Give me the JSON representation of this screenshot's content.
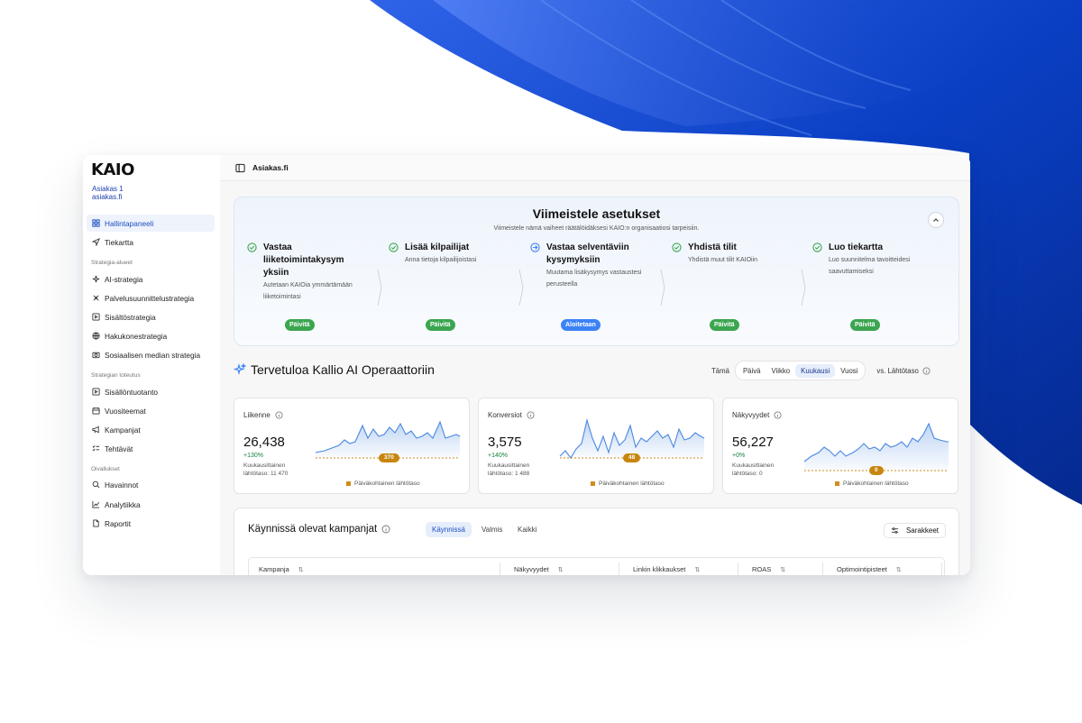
{
  "sidebar": {
    "logo": "KAIO",
    "account_name": "Asiakas 1",
    "account_domain": "asiakas.fi",
    "items": [
      {
        "label": "Hallintapaneeli",
        "icon": "grid-icon",
        "active": true
      },
      {
        "label": "Tiekartta",
        "icon": "navigation-icon"
      }
    ],
    "section1": "Strategia-alueet",
    "strategy_items": [
      {
        "label": "AI-strategia",
        "icon": "sparkles-icon"
      },
      {
        "label": "Palvelusuunnittelustrategia",
        "icon": "compass-icon"
      },
      {
        "label": "Sisältöstrategia",
        "icon": "play-square-icon"
      },
      {
        "label": "Hakukonestrategia",
        "icon": "globe-icon"
      },
      {
        "label": "Sosiaalisen median strategia",
        "icon": "camera-icon"
      }
    ],
    "section2": "Strategian toteutus",
    "execution_items": [
      {
        "label": "Sisällöntuotanto",
        "icon": "play-square-icon"
      },
      {
        "label": "Vuositeemat",
        "icon": "calendar-icon"
      },
      {
        "label": "Kampanjat",
        "icon": "megaphone-icon"
      },
      {
        "label": "Tehtävät",
        "icon": "list-check-icon"
      }
    ],
    "section3": "Oivallukset",
    "insight_items": [
      {
        "label": "Havainnot",
        "icon": "search-icon"
      },
      {
        "label": "Analytiikka",
        "icon": "chart-line-icon"
      },
      {
        "label": "Raportit",
        "icon": "file-icon"
      }
    ]
  },
  "topbar": {
    "title": "Asiakas.fi",
    "icon": "sidebar-toggle-icon"
  },
  "setup": {
    "title": "Viimeistele asetukset",
    "subtitle": "Viimeistele nämä vaiheet räätälöidäksesi KAIO:n organisaatiosi tarpeisiin.",
    "steps": [
      {
        "title": "Vastaa liiketoimintakysym yksiin",
        "desc": "Autetaan KAIOia ymmärtämään liiketoimintasi",
        "button": "Päivitä",
        "status": "done"
      },
      {
        "title": "Lisää kilpailijat",
        "desc": "Anna tietoja kilpailijoistasi",
        "button": "Päivitä",
        "status": "done"
      },
      {
        "title": "Vastaa selventäviin kysymyksiin",
        "desc": "Muutama lisäkysymys vastaustesi perusteella",
        "button": "Aloitetaan",
        "status": "current"
      },
      {
        "title": "Yhdistä tilit",
        "desc": "Yhdistä muut tilit KAIOiin",
        "button": "Päivitä",
        "status": "done"
      },
      {
        "title": "Luo tiekartta",
        "desc": "Luo suunnitelma tavoitteidesi saavuttamiseksi",
        "button": "Päivitä",
        "status": "done"
      }
    ]
  },
  "welcome": {
    "title": "Tervetuloa Kallio AI Operaattoriin"
  },
  "period": {
    "label": "Tämä",
    "options": [
      "Päivä",
      "Viikko",
      "Kuukausi",
      "Vuosi"
    ],
    "selected": "Kuukausi",
    "compare": "vs. Lähtötaso"
  },
  "kpis": [
    {
      "name": "Liikenne",
      "value": "26,438",
      "change": "+130%",
      "baseline_label": "Kuukausittainen lähtötaso: 11 470",
      "baseline_badge": "370",
      "legend": "Päiväkohtainen lähtötaso"
    },
    {
      "name": "Konversiot",
      "value": "3,575",
      "change": "+140%",
      "baseline_label": "Kuukausittainen lähtötaso: 1 488",
      "baseline_badge": "48",
      "legend": "Päiväkohtainen lähtötaso"
    },
    {
      "name": "Näkyvyydet",
      "value": "56,227",
      "change": "+0%",
      "baseline_label": "Kuukausittainen lähtötaso: 0",
      "baseline_badge": "0",
      "legend": "Päiväkohtainen lähtötaso"
    }
  ],
  "campaigns": {
    "title": "Käynnissä olevat kampanjat",
    "tabs": [
      "Käynnissä",
      "Valmis",
      "Kaikki"
    ],
    "active_tab": "Käynnissä",
    "columns_button": "Sarakkeet",
    "columns": [
      "Kampanja",
      "Näkyvyydet",
      "Linkin klikkaukset",
      "ROAS",
      "Optimointipisteet"
    ]
  },
  "colors": {
    "accent": "#1e4fc2",
    "success": "#3ba650",
    "baseline": "#d08c1a",
    "line": "#4a88e0"
  }
}
